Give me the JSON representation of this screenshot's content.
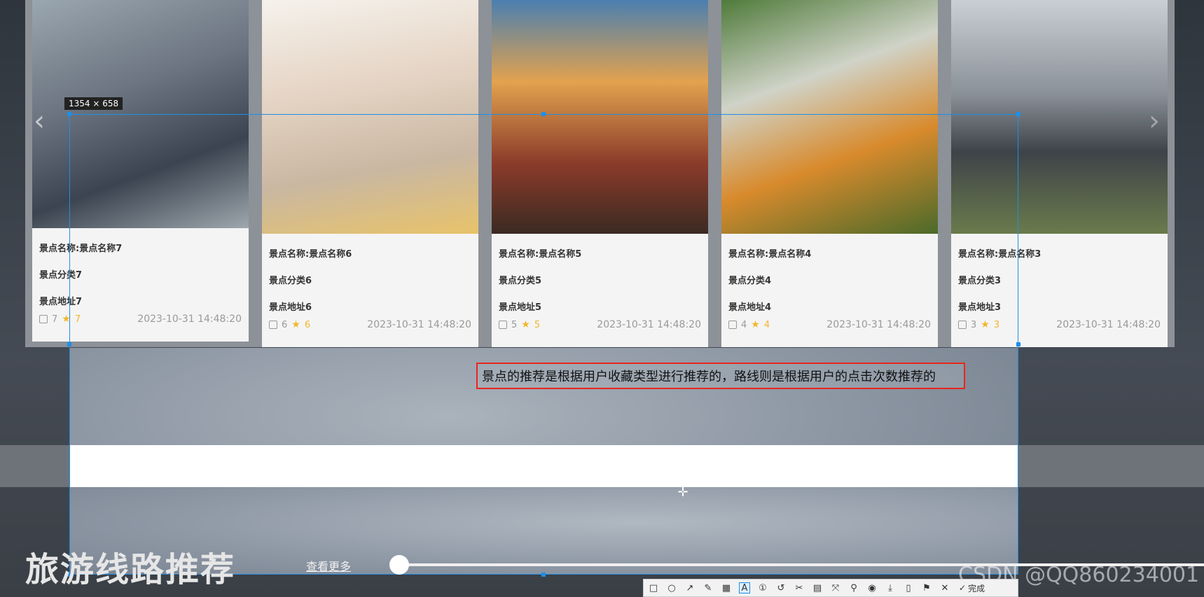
{
  "selection_size": "1354 × 658",
  "cards": [
    {
      "name": "景点名称:景点名称7",
      "category": "景点分类7",
      "address": "景点地址7",
      "likes": "7",
      "favorites": "7",
      "date": "2023-10-31 14:48:20"
    },
    {
      "name": "景点名称:景点名称6",
      "category": "景点分类6",
      "address": "景点地址6",
      "likes": "6",
      "favorites": "6",
      "date": "2023-10-31 14:48:20"
    },
    {
      "name": "景点名称:景点名称5",
      "category": "景点分类5",
      "address": "景点地址5",
      "likes": "5",
      "favorites": "5",
      "date": "2023-10-31 14:48:20"
    },
    {
      "name": "景点名称:景点名称4",
      "category": "景点分类4",
      "address": "景点地址4",
      "likes": "4",
      "favorites": "4",
      "date": "2023-10-31 14:48:20"
    },
    {
      "name": "景点名称:景点名称3",
      "category": "景点分类3",
      "address": "景点地址3",
      "likes": "3",
      "favorites": "3",
      "date": "2023-10-31 14:48:20"
    }
  ],
  "annotation_text": "景点的推荐是根据用户收藏类型进行推荐的，路线则是根据用户的点击次数推荐的",
  "section": {
    "title": "旅游线路推荐",
    "more_label": "查看更多"
  },
  "watermark": "CSDN @QQ860234001",
  "toolbar": {
    "done_label": "完成"
  },
  "colors": {
    "selection_border": "#1e8fe8",
    "annotation_border": "#e8261c",
    "favorite": "#f2b62c"
  }
}
